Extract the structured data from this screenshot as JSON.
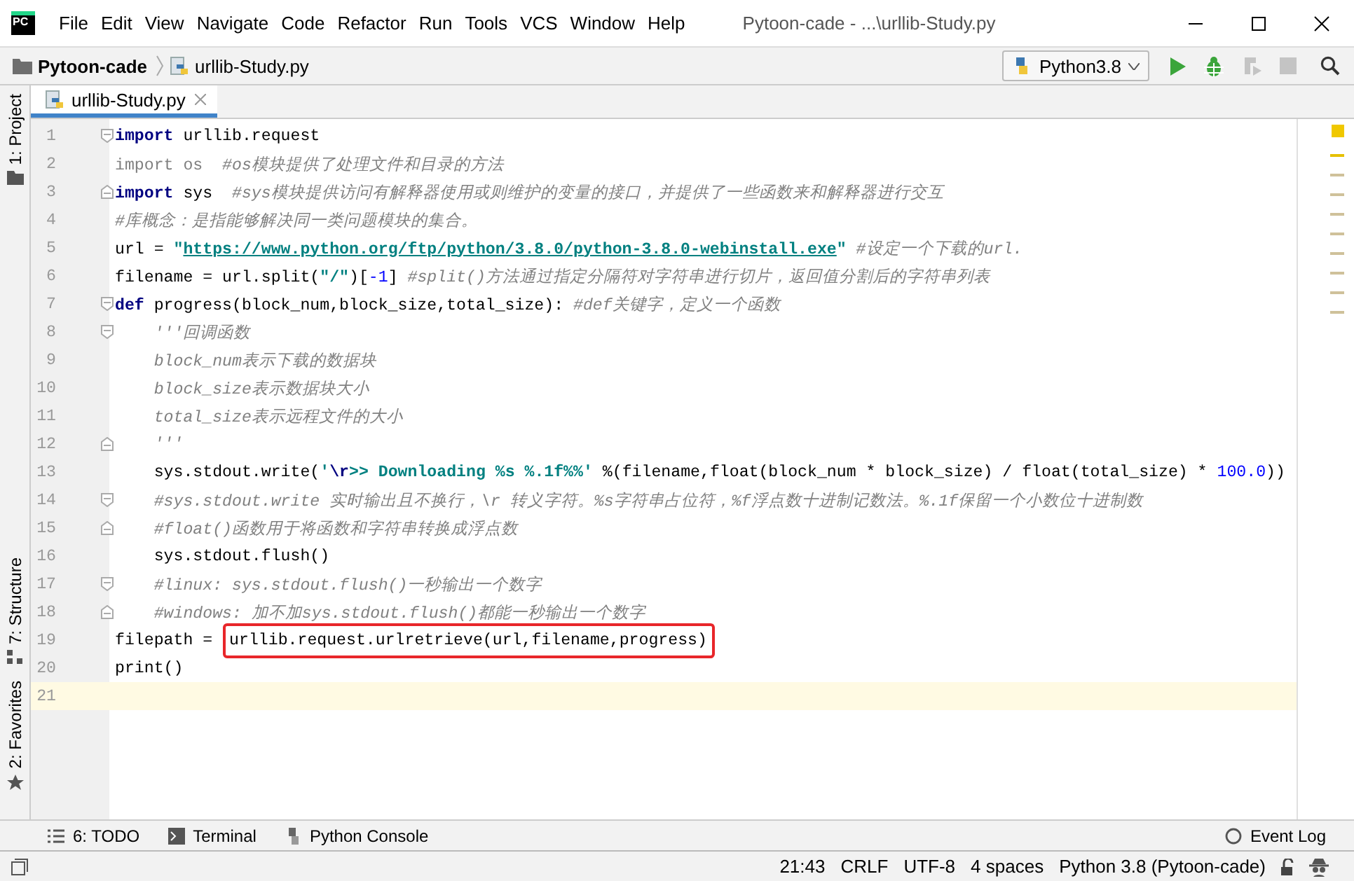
{
  "window": {
    "logo": "PC",
    "title": "Pytoon-cade - ...\\urllib-Study.py"
  },
  "menu": [
    {
      "label": "File"
    },
    {
      "label": "Edit"
    },
    {
      "label": "View"
    },
    {
      "label": "Navigate"
    },
    {
      "label": "Code"
    },
    {
      "label": "Refactor"
    },
    {
      "label": "Run"
    },
    {
      "label": "Tools"
    },
    {
      "label": "VCS"
    },
    {
      "label": "Window"
    },
    {
      "label": "Help"
    }
  ],
  "breadcrumbs": [
    {
      "label": "Pytoon-cade",
      "kind": "project"
    },
    {
      "label": "urllib-Study.py",
      "kind": "file"
    }
  ],
  "run_config": {
    "label": "Python3.8"
  },
  "toolbar": [
    {
      "kind": "run",
      "disabled": false
    },
    {
      "kind": "debug",
      "disabled": false
    },
    {
      "kind": "coverage",
      "disabled": true
    },
    {
      "kind": "stop",
      "disabled": true
    },
    {
      "kind": "search",
      "disabled": false
    }
  ],
  "side_tabs": [
    {
      "label": "1: Project",
      "kind": "project"
    },
    {
      "label": "7: Structure",
      "kind": "structure"
    },
    {
      "label": "2: Favorites",
      "kind": "favorites"
    }
  ],
  "editor_tabs": [
    {
      "label": "urllib-Study.py",
      "selected": true
    }
  ],
  "code": [
    {
      "number": "1",
      "kind": "fold_start",
      "current": false,
      "tokens": [
        {
          "text": "import",
          "kind": "keyword"
        },
        {
          "text": " urllib.request",
          "kind": "plain"
        }
      ]
    },
    {
      "number": "2",
      "current": false,
      "tokens": [
        {
          "text": "import os",
          "kind": "unused"
        },
        {
          "text": "  #os模块提供了处理文件和目录的方法",
          "kind": "comment"
        }
      ]
    },
    {
      "number": "3",
      "kind": "fold_end",
      "current": false,
      "tokens": [
        {
          "text": "import",
          "kind": "keyword"
        },
        {
          "text": " sys  ",
          "kind": "plain"
        },
        {
          "text": "#sys模块提供访问有解释器使用或则维护的变量的接口，并提供了一些函数来和解释器进行交互",
          "kind": "comment"
        }
      ]
    },
    {
      "number": "4",
      "current": false,
      "tokens": [
        {
          "text": "#库概念：是指能够解决同一类问题模块的集合。",
          "kind": "comment"
        }
      ]
    },
    {
      "number": "5",
      "current": false,
      "tokens": [
        {
          "text": "url = ",
          "kind": "plain"
        },
        {
          "text": "\"",
          "kind": "string"
        },
        {
          "text": "https://www.python.org/ftp/python/3.8.0/python-3.8.0-webinstall.exe",
          "kind": "link"
        },
        {
          "text": "\"",
          "kind": "string"
        },
        {
          "text": " #设定一个下载的url.",
          "kind": "comment"
        }
      ]
    },
    {
      "number": "6",
      "current": false,
      "tokens": [
        {
          "text": "filename = url.split(",
          "kind": "plain"
        },
        {
          "text": "\"/\"",
          "kind": "string"
        },
        {
          "text": ")[",
          "kind": "plain"
        },
        {
          "text": "-1",
          "kind": "number"
        },
        {
          "text": "] ",
          "kind": "plain"
        },
        {
          "text": "#split()方法通过指定分隔符对字符串进行切片，返回值分割后的字符串列表",
          "kind": "comment"
        }
      ]
    },
    {
      "number": "7",
      "kind": "fold_start",
      "current": false,
      "tokens": [
        {
          "text": "def",
          "kind": "keyword"
        },
        {
          "text": " progress(block_num,block_size,total_size): ",
          "kind": "plain"
        },
        {
          "text": "#def关键字，定义一个函数",
          "kind": "comment"
        }
      ]
    },
    {
      "number": "8",
      "kind": "fold_start",
      "current": false,
      "indented": true,
      "tokens": [
        {
          "text": "'''回调函数",
          "kind": "docstring"
        }
      ]
    },
    {
      "number": "9",
      "current": false,
      "indented": true,
      "tokens": [
        {
          "text": "block_num表示下载的数据块",
          "kind": "docstring"
        }
      ]
    },
    {
      "number": "10",
      "current": false,
      "indented": true,
      "tokens": [
        {
          "text": "block_size表示数据块大小",
          "kind": "docstring"
        }
      ]
    },
    {
      "number": "11",
      "current": false,
      "indented": true,
      "tokens": [
        {
          "text": "total_size表示远程文件的大小",
          "kind": "docstring"
        }
      ]
    },
    {
      "number": "12",
      "kind": "fold_end",
      "current": false,
      "indented": true,
      "tokens": [
        {
          "text": "'''",
          "kind": "docstring"
        }
      ]
    },
    {
      "number": "13",
      "current": false,
      "indented": true,
      "tokens": [
        {
          "text": "sys.stdout.write(",
          "kind": "plain"
        },
        {
          "text": "'",
          "kind": "string"
        },
        {
          "text": "\\r",
          "kind": "escape"
        },
        {
          "text": ">> Downloading %s %.1f%%",
          "kind": "string"
        },
        {
          "text": "'",
          "kind": "string"
        },
        {
          "text": " %(filename,float(block_num * block_size) / float(total_size) * ",
          "kind": "plain"
        },
        {
          "text": "100.0",
          "kind": "number"
        },
        {
          "text": "))",
          "kind": "plain"
        }
      ]
    },
    {
      "number": "14",
      "kind": "fold_start",
      "current": false,
      "indented": true,
      "tokens": [
        {
          "text": "#sys.stdout.write 实时输出且不换行，\\r 转义字符。%s字符串占位符，%f浮点数十进制记数法。%.1f保留一个小数位十进制数",
          "kind": "comment"
        }
      ]
    },
    {
      "number": "15",
      "kind": "fold_end",
      "current": false,
      "indented": true,
      "tokens": [
        {
          "text": "#float()函数用于将函数和字符串转换成浮点数",
          "kind": "comment"
        }
      ]
    },
    {
      "number": "16",
      "current": false,
      "indented": true,
      "tokens": [
        {
          "text": "sys.stdout.flush()",
          "kind": "plain"
        }
      ]
    },
    {
      "number": "17",
      "kind": "fold_start",
      "current": false,
      "indented": true,
      "tokens": [
        {
          "text": "#linux: sys.stdout.flush()一秒输出一个数字",
          "kind": "comment"
        }
      ]
    },
    {
      "number": "18",
      "kind": "fold_end",
      "current": false,
      "indented": true,
      "tokens": [
        {
          "text": "#windows: 加不加sys.stdout.flush()都能一秒输出一个数字",
          "kind": "comment"
        }
      ]
    },
    {
      "number": "19",
      "current": false,
      "tokens": [
        {
          "text": "filepath = ",
          "kind": "plain"
        },
        {
          "text": "urllib.request.urlretrieve(url,filename,progress)",
          "kind": "plain",
          "highlighted": true
        }
      ]
    },
    {
      "number": "20",
      "current": false,
      "tokens": [
        {
          "text": "print()",
          "kind": "plain"
        }
      ]
    },
    {
      "number": "21",
      "current": true
    }
  ],
  "tool_windows": [
    {
      "label": "6: TODO",
      "kind": "todo"
    },
    {
      "label": "Terminal",
      "kind": "terminal"
    },
    {
      "label": "Python Console",
      "kind": "console"
    }
  ],
  "event_log": {
    "label": "Event Log"
  },
  "status_bar": [
    {
      "text": "21:43"
    },
    {
      "text": "CRLF"
    },
    {
      "text": "UTF-8"
    },
    {
      "text": "4 spaces"
    },
    {
      "text": "Python 3.8 (Pytoon-cade)"
    }
  ]
}
